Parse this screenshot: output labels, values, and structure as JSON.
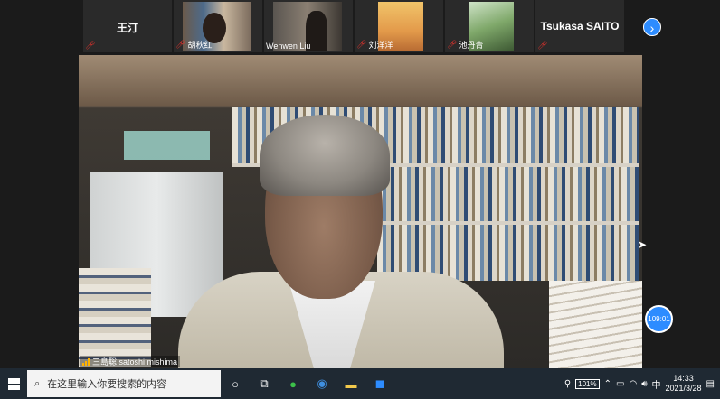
{
  "participants": [
    {
      "name": "王汀",
      "label": ""
    },
    {
      "name": "",
      "label": "胡秋红"
    },
    {
      "name": "",
      "label": "Wenwen Liu"
    },
    {
      "name": "",
      "label": "刘洋洋"
    },
    {
      "name": "",
      "label": "池丹青"
    },
    {
      "name": "Tsukasa SAITO",
      "label": ""
    }
  ],
  "speaker_label": "三島聡 satoshi mishima",
  "timer": "109:01",
  "taskbar": {
    "search_placeholder": "在这里输入你要搜索的内容",
    "hw_badge": "101%",
    "ime": "中",
    "time": "14:33",
    "date": "2021/3/28"
  },
  "colors": {
    "accent": "#2d8cff",
    "mute": "#e5322c",
    "taskbar": "#1f2933"
  }
}
